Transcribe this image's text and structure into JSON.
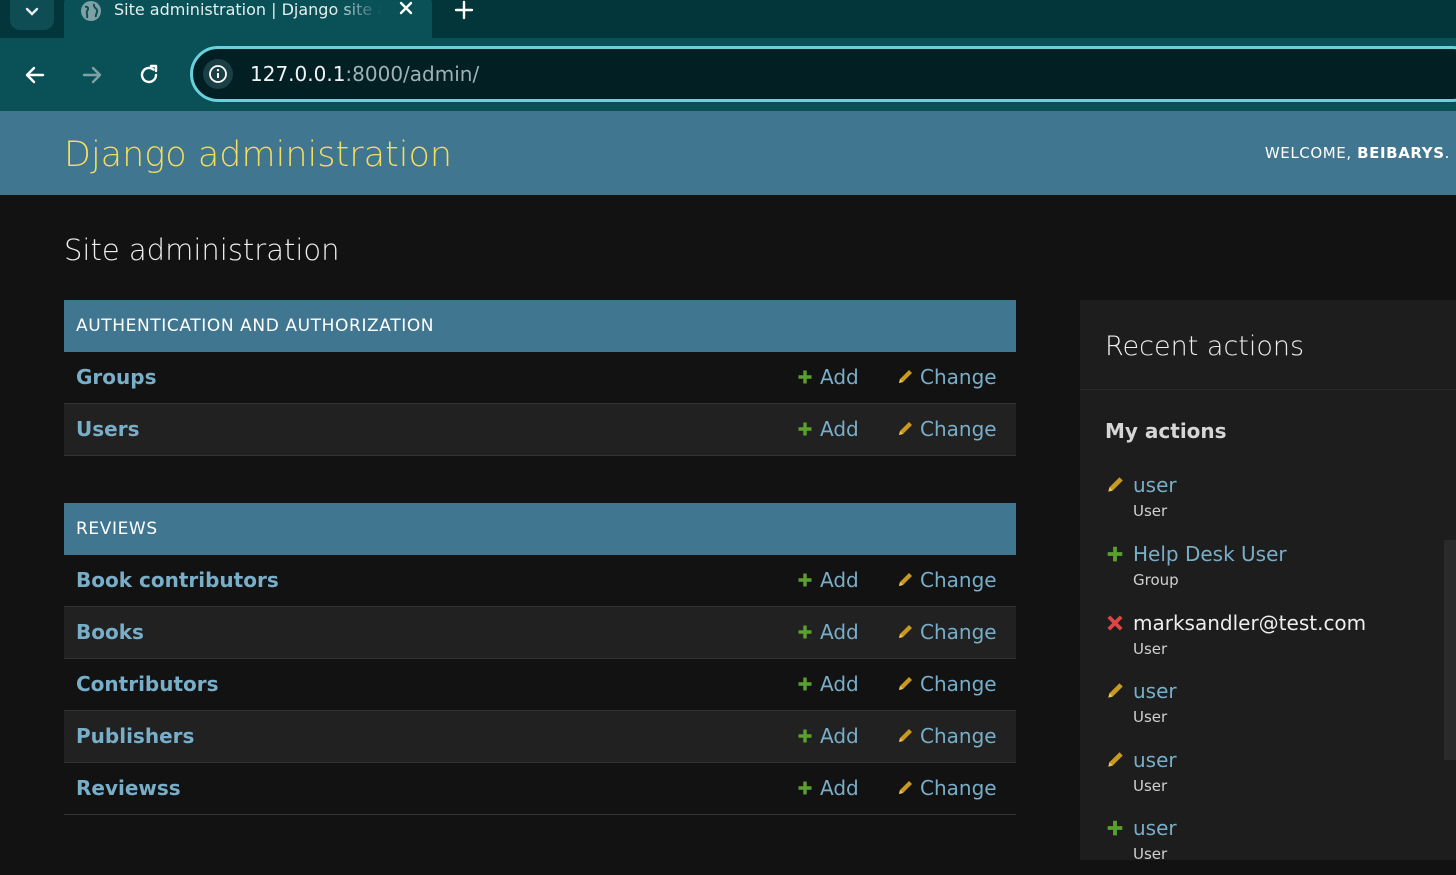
{
  "browser": {
    "tab_title": "Site administration | Django site admin",
    "url_host": "127.0.0.1",
    "url_rest": ":8000/admin/"
  },
  "header": {
    "branding": "Django administration",
    "welcome": "WELCOME,",
    "username": "BEIBARYS",
    "welcome_suffix": "."
  },
  "content": {
    "title": "Site administration"
  },
  "apps": [
    {
      "caption": "AUTHENTICATION AND AUTHORIZATION",
      "models": [
        {
          "name": "Groups",
          "add": "Add",
          "change": "Change"
        },
        {
          "name": "Users",
          "add": "Add",
          "change": "Change"
        }
      ]
    },
    {
      "caption": "REVIEWS",
      "models": [
        {
          "name": "Book contributors",
          "add": "Add",
          "change": "Change"
        },
        {
          "name": "Books",
          "add": "Add",
          "change": "Change"
        },
        {
          "name": "Contributors",
          "add": "Add",
          "change": "Change"
        },
        {
          "name": "Publishers",
          "add": "Add",
          "change": "Change"
        },
        {
          "name": "Reviewss",
          "add": "Add",
          "change": "Change"
        }
      ]
    }
  ],
  "recent": {
    "title": "Recent actions",
    "subtitle": "My actions",
    "items": [
      {
        "action": "change",
        "icon": "pencil-icon",
        "label": "user",
        "type": "User"
      },
      {
        "action": "add",
        "icon": "plus-icon",
        "label": "Help Desk User",
        "type": "Group"
      },
      {
        "action": "delete",
        "icon": "delete-icon",
        "label": "marksandler@test.com",
        "type": "User"
      },
      {
        "action": "change",
        "icon": "pencil-icon",
        "label": "user",
        "type": "User"
      },
      {
        "action": "change",
        "icon": "pencil-icon",
        "label": "user",
        "type": "User"
      },
      {
        "action": "add",
        "icon": "plus-icon",
        "label": "user",
        "type": "User"
      }
    ]
  },
  "colors": {
    "header_bg": "#417690",
    "branding": "#f5dd5d",
    "link": "#79aec8",
    "add_icon": "#5aa02c",
    "change_icon": "#c89b1e",
    "delete_icon": "#dd4646",
    "body_bg": "#121212"
  }
}
